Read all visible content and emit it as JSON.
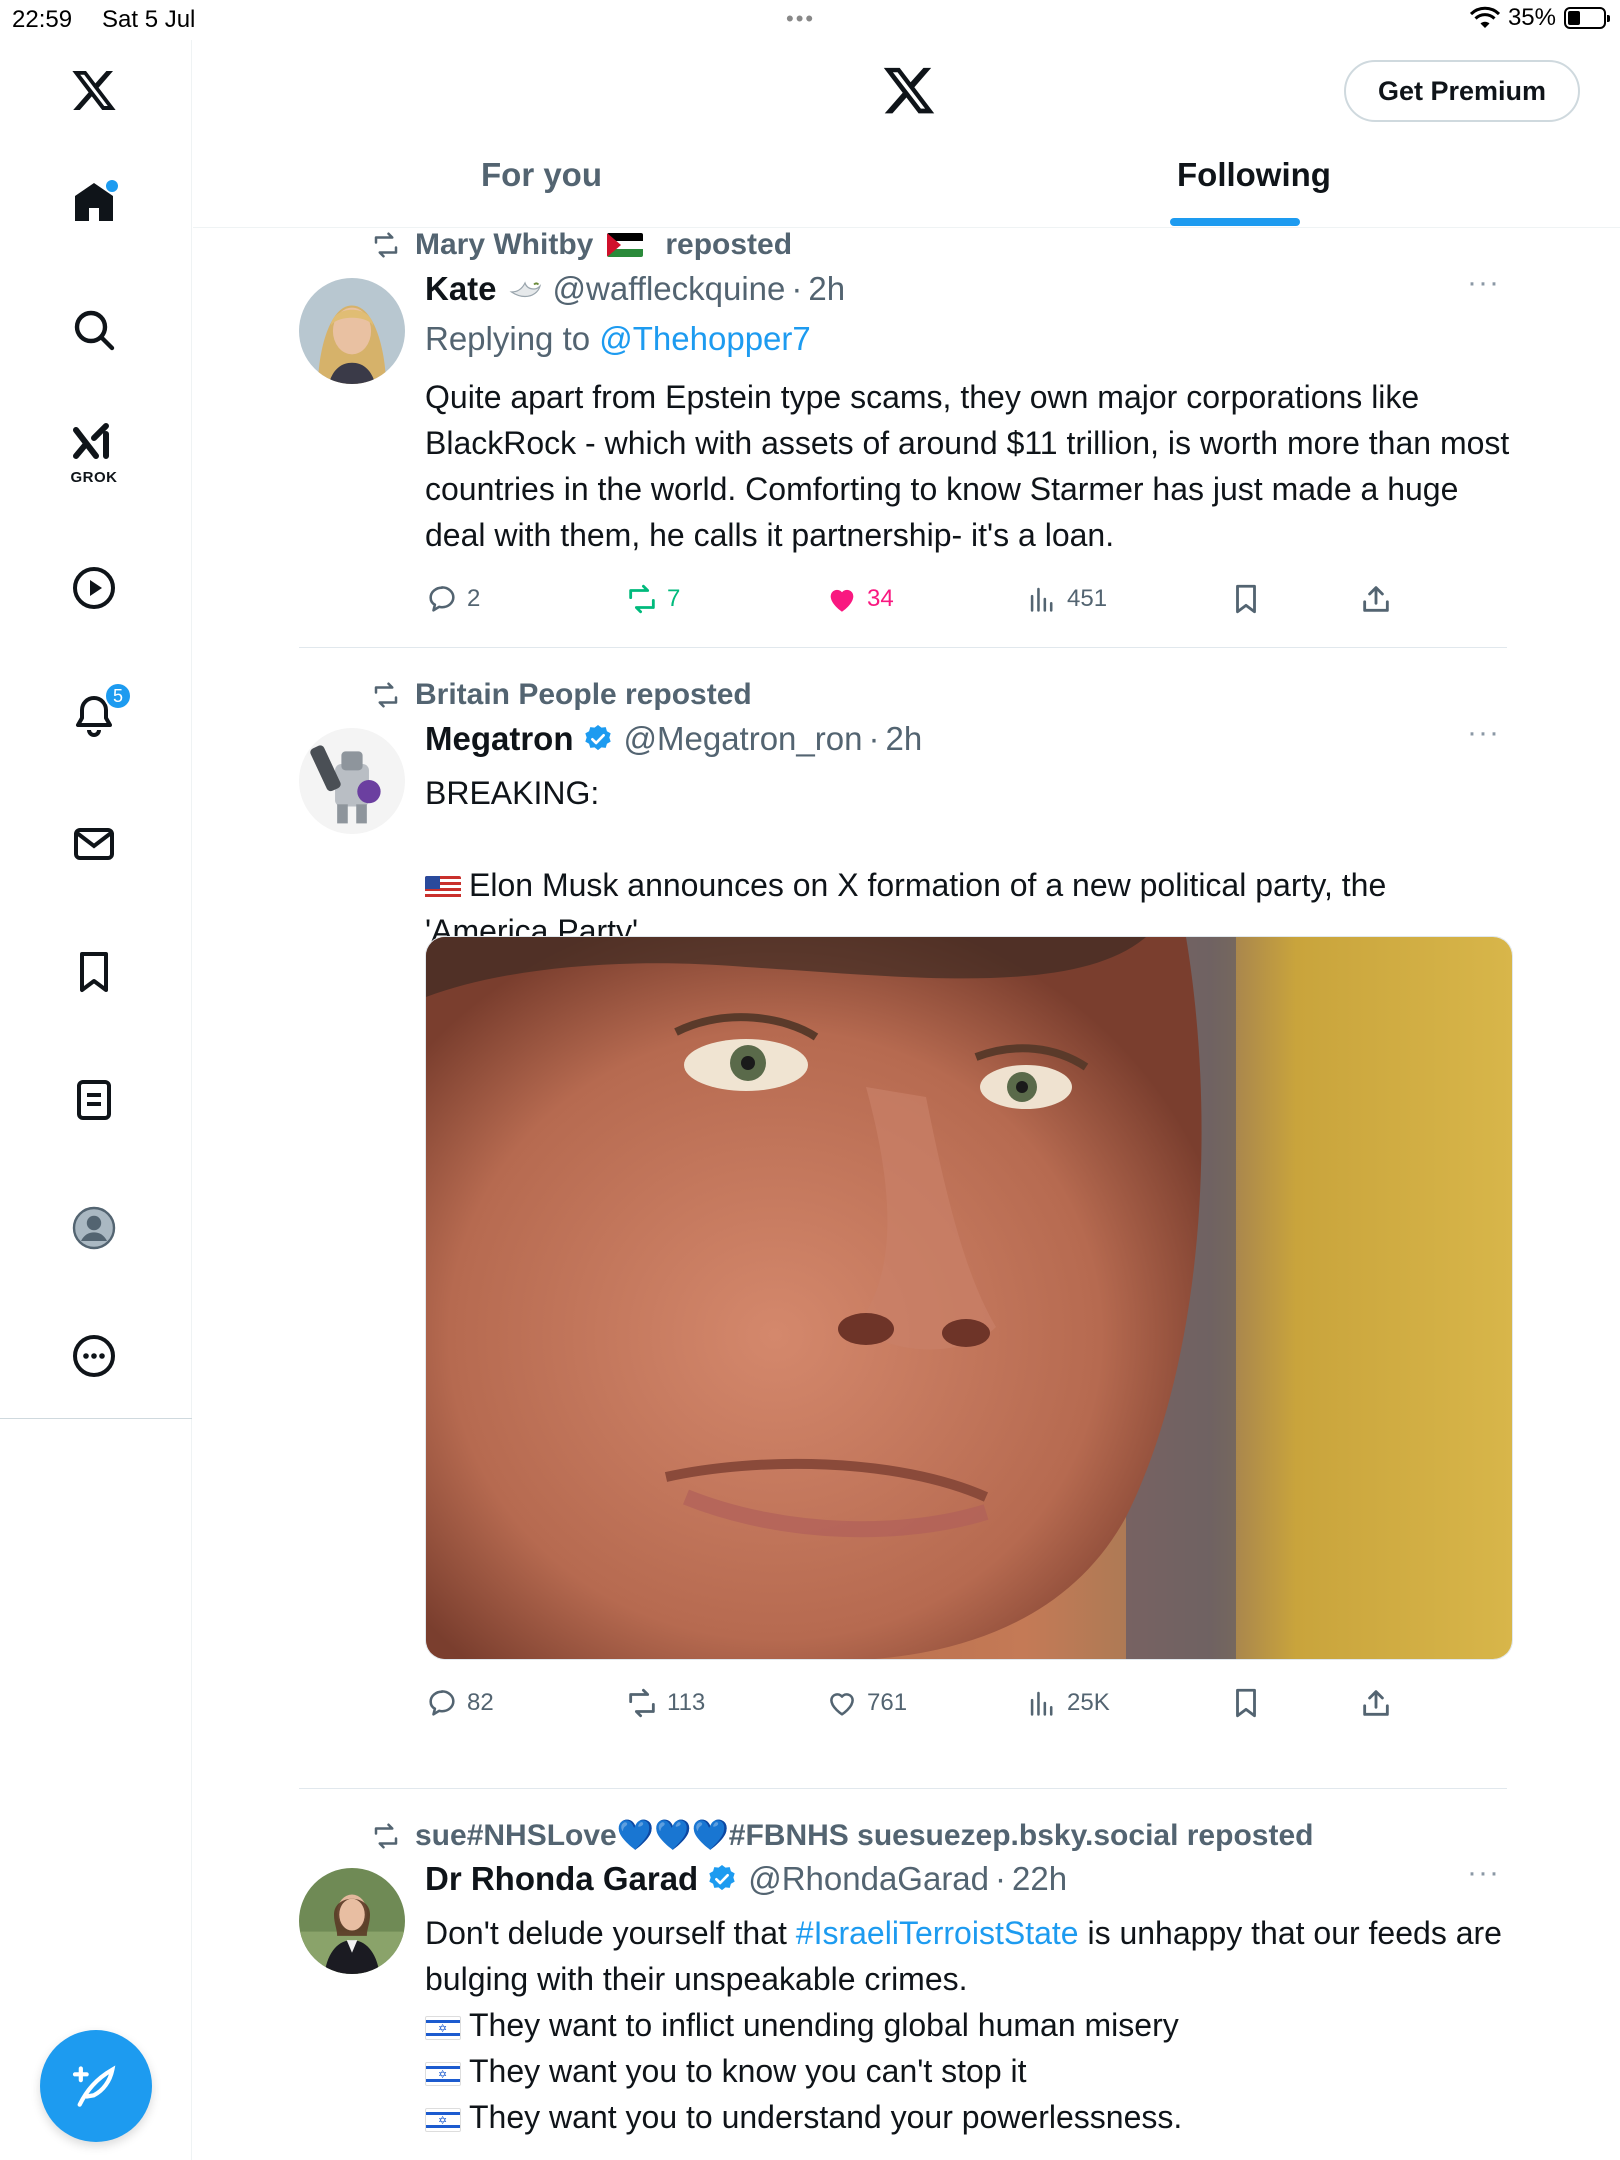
{
  "status": {
    "time": "22:59",
    "date": "Sat 5 Jul",
    "battery": "35%"
  },
  "header": {
    "premium_label": "Get Premium",
    "tabs": [
      "For you",
      "Following"
    ],
    "active_tab": "Following"
  },
  "sidebar": {
    "grok_label": "GROK",
    "notifications_count": "5"
  },
  "colors": {
    "accent": "#1d9bf0",
    "like": "#f91880",
    "repost": "#00ba7c",
    "muted": "#536471"
  },
  "posts": [
    {
      "repost_by": "Mary Whitby",
      "repost_suffix": "reposted",
      "name": "Kate",
      "handle": "@waffleckquine",
      "time": "2h",
      "replying_prefix": "Replying to ",
      "replying_to": "@Thehopper7",
      "text": "Quite apart from Epstein type scams, they own major corporations like BlackRock - which with assets of around $11 trillion, is worth more than most countries in the world. Comforting to know Starmer has just made a huge deal with them, he calls it partnership- it's a loan.",
      "replies": "2",
      "reposts": "7",
      "likes": "34",
      "views": "451"
    },
    {
      "repost_by": "Britain People reposted",
      "name": "Megatron",
      "handle": "@Megatron_ron",
      "time": "2h",
      "text_line1": "BREAKING:",
      "text_line2": "Elon Musk announces on X formation of a new political party, the 'America Party'",
      "replies": "82",
      "reposts": "113",
      "likes": "761",
      "views": "25K"
    },
    {
      "repost_by": "sue#NHSLove💙💙💙#FBNHS suesuezep.bsky.social reposted",
      "name": "Dr Rhonda Garad",
      "handle": "@RhondaGarad",
      "time": "22h",
      "text_a": "Don't delude yourself that ",
      "hashtag": "#IsraeliTerroistState",
      "text_b": " is unhappy that our feeds are bulging with their unspeakable crimes.",
      "bullet1": "They want to inflict unending global human misery",
      "bullet2": "They want you to know you can't stop it",
      "bullet3": "They want you to understand your powerlessness."
    }
  ]
}
